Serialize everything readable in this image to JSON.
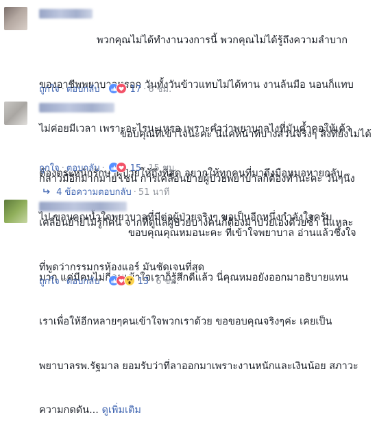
{
  "comments": [
    {
      "text_lines": [
        "พวกคุณไม่ได้ทำงานวงการนี้ พวกคุณไม่ได้รู้ถึงความลำบาก",
        "ของอาชีพพยาบาลหรอก วันทั้งวันข้าวแทบไม่ได้ทาน งานล้นมือ นอนก็แทบ",
        "ไม่ค่อยมีเวลา เพราะอะไรนะเหรอ เพราะคำว่าพยาบาลไงที่มันค้ำคอให้เค้า",
        "ต้องตระหนักรักษาผู้ป่วยให้ถึงที่สุด อยากให้ทุกคนที่มาถึงมือหมอหายกลับ",
        "ไป ขอบคุณน้ำใจพยาบาลที่มีต่อผู้ป่วยจริงๆ ขอเป็นอีกหนึ่งกำลังใจครับ"
      ],
      "like_label": "ถูกใจ",
      "reply_label": "ตอบกลับ",
      "reactions": [
        "like",
        "love"
      ],
      "reaction_count": "17",
      "time": "6 ชม."
    },
    {
      "text_lines": [
        "ขอบคุณที่เข้าใจนะคะ นี่แค่หน้าที่บางส่วนจริงๆ สิ่งที่ยังไม่ได้",
        "กล่าวมีอีกมากมาย เช่น การเคลื่อนย้ายผู้ป่วยพยาบาลก็ต้องทำนะคะ วันๆนึง",
        "เคลื่อนย้ายไม่รู้กี่คน จากที่ดูแลผู้ป่วยบางคนก็ต้องมาป่วยเองด้วยซ้ำ นี่แหละ",
        "ที่พูดว่ากรรมกรห้องแอร์ มันชัดเจนที่สุด"
      ],
      "like_label": "ถูกใจ",
      "reply_label": "ตอบกลับ",
      "reactions": [
        "like",
        "love"
      ],
      "reaction_count": "15",
      "time": "15 ชม."
    },
    {
      "text_lines": [
        "ขอบคุณคุณหมอนะคะ ที่เข้าใจพยาบาล อ่านแล้วซึ้งใจ",
        "มาก แค่มีคนไม่กี่คนเข้าใจเราก็รู้สึกดีแล้ว นี่คุณหมอยังออกมาอธิบายแทน",
        "เราเพื่อให้อีกหลายๆคนเข้าใจพวกเราด้วย ขอขอบคุณจริงๆค่ะ เคยเป็น",
        "พยาบาลรพ.รัฐมาล ยอมรับว่าที่ลาออกมาเพราะงานหนักและเงินน้อย สภาวะ"
      ],
      "last_line": "ความกดดัน...",
      "see_more": "ดูเพิ่มเติม",
      "like_label": "ถูกใจ",
      "reply_label": "ตอบกลับ",
      "reactions": [
        "like",
        "love",
        "wow"
      ],
      "reaction_count": "13",
      "time": "6 ชม."
    }
  ],
  "replies_toggle": {
    "label": "4 ข้อความตอบกลับ",
    "time": "51 นาที"
  },
  "colors": {
    "link": "#4267b2",
    "meta": "#90949c",
    "text": "#1d2129",
    "like_blue": "#5890ff",
    "love_red": "#f25268",
    "wow_yellow": "#fcd34d"
  }
}
